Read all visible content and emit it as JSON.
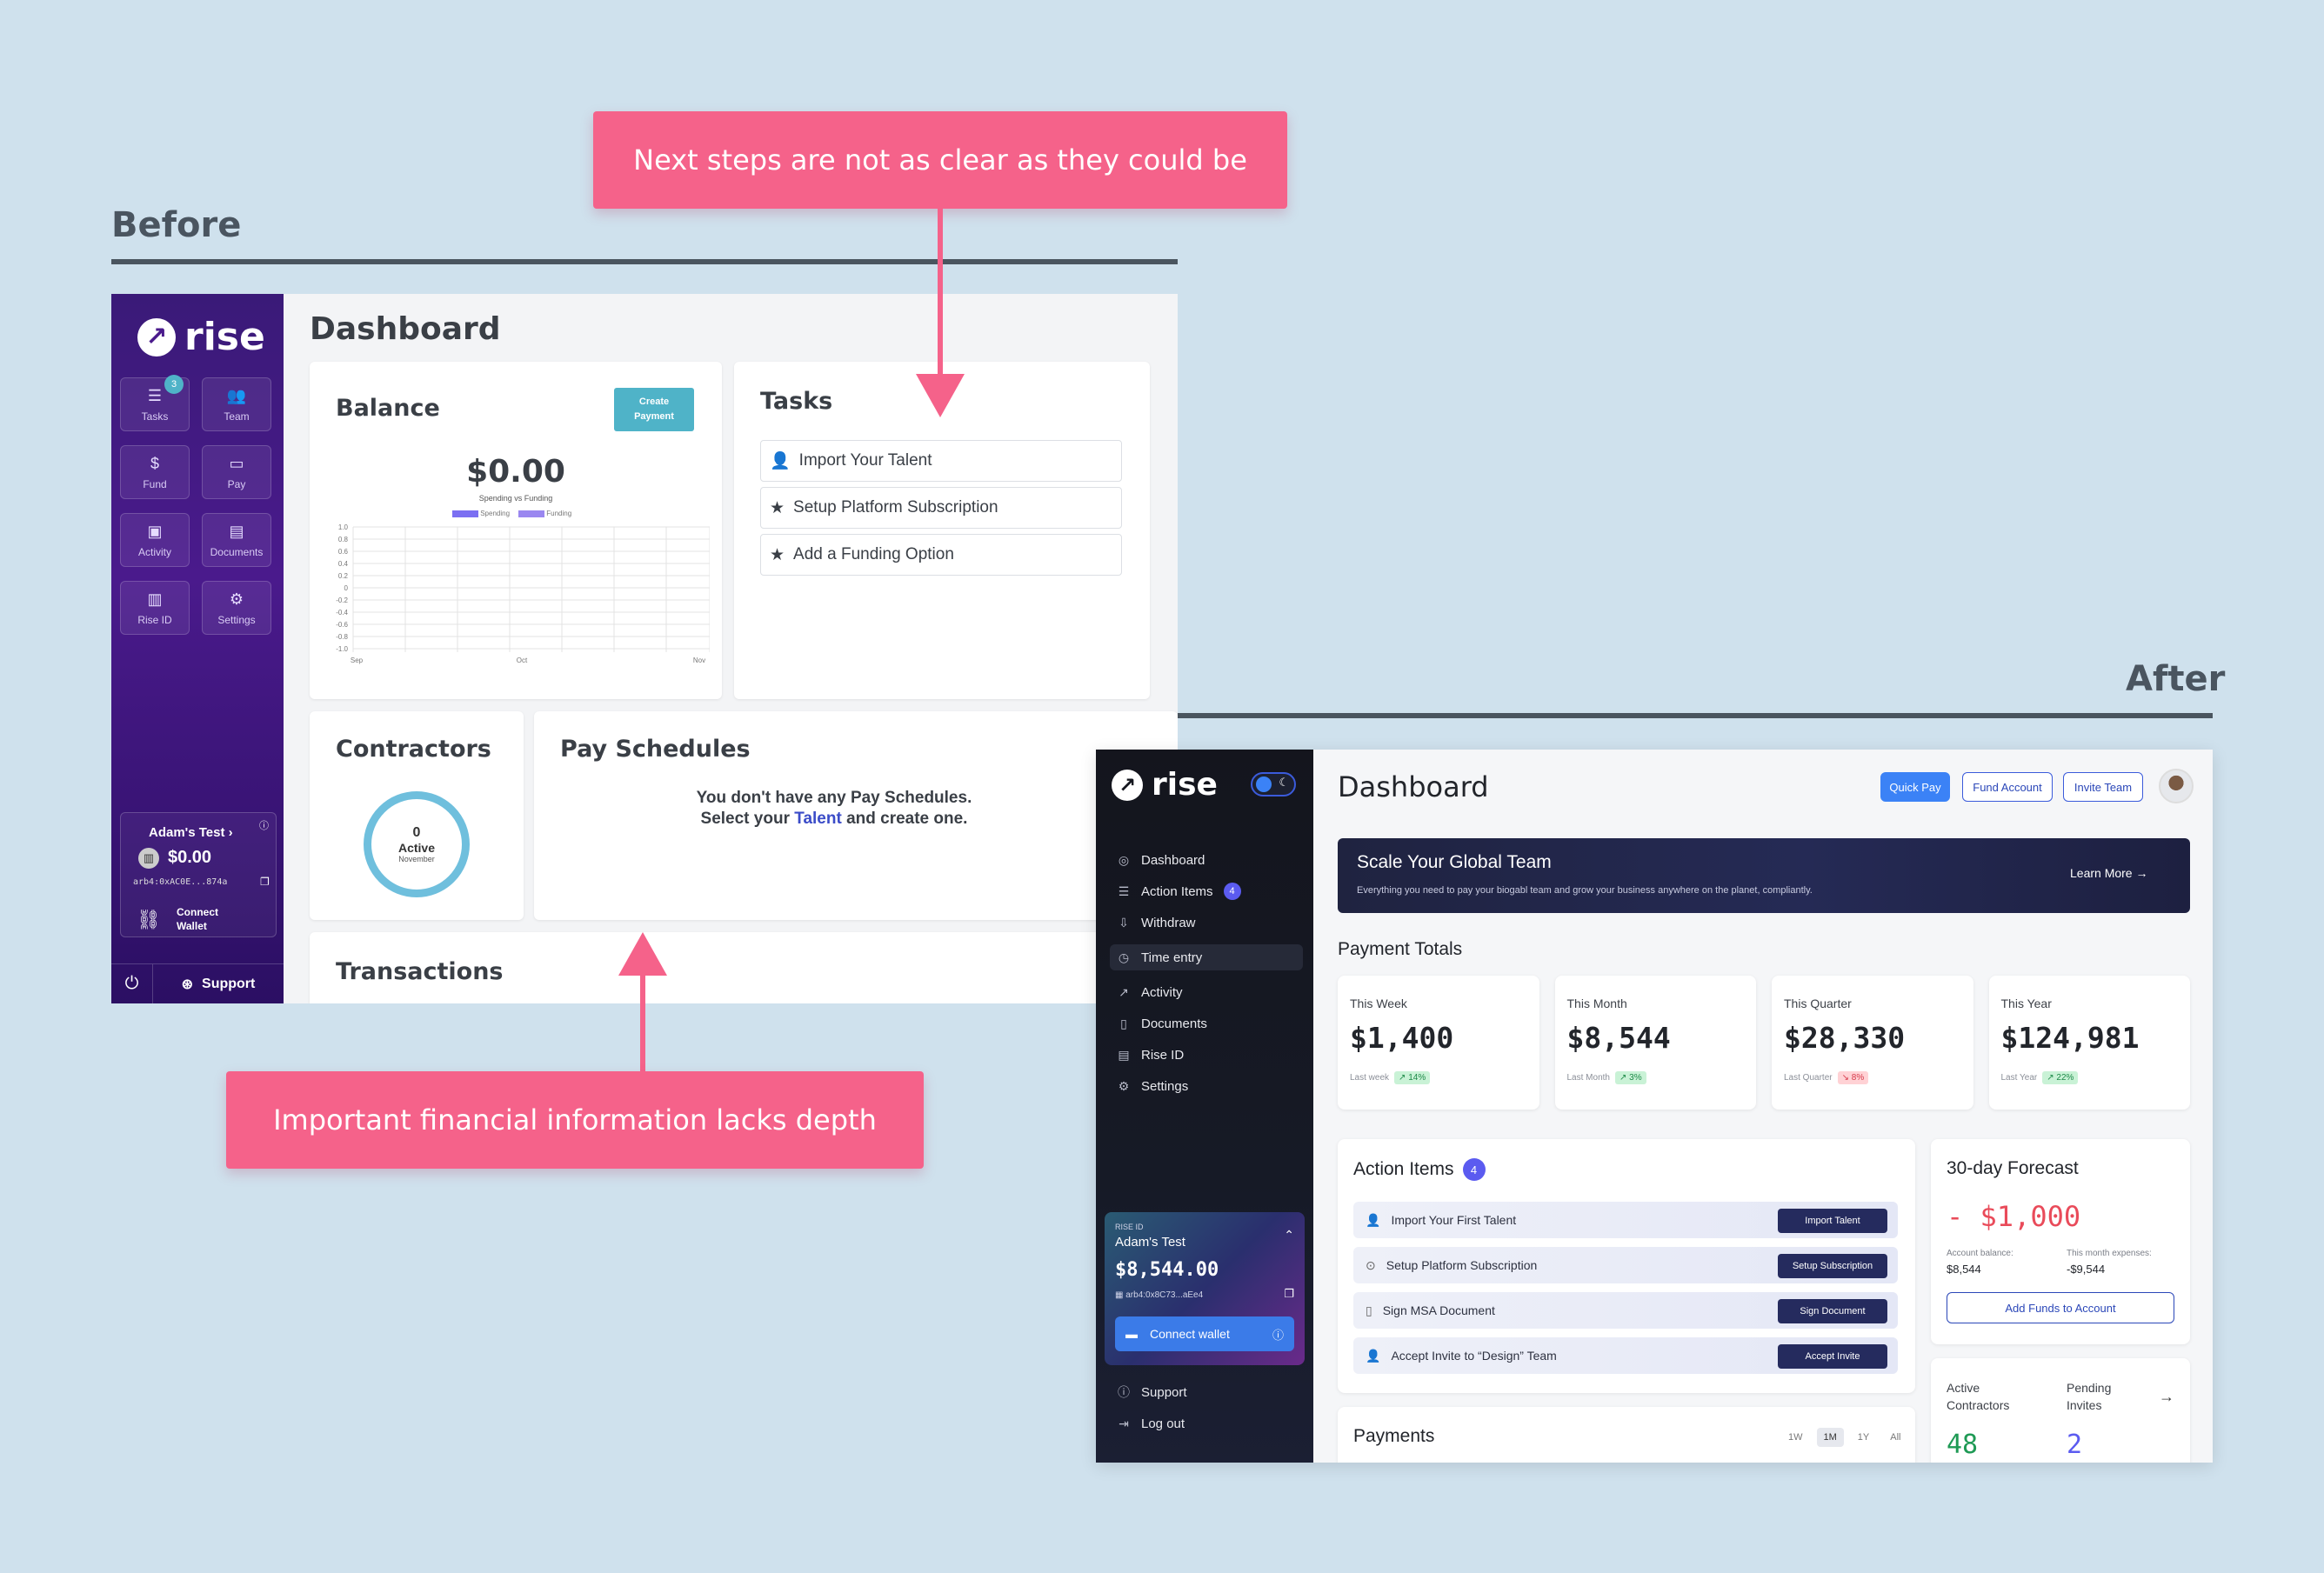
{
  "labels": {
    "before": "Before",
    "after": "After"
  },
  "callouts": {
    "top": "Next steps are not as clear as they could be",
    "bottom": "Important financial information lacks depth"
  },
  "before": {
    "logo": "rise",
    "nav": [
      {
        "label": "Tasks",
        "icon": "tasks-icon",
        "badge": "3"
      },
      {
        "label": "Team",
        "icon": "team-icon"
      },
      {
        "label": "Fund",
        "icon": "fund-icon"
      },
      {
        "label": "Pay",
        "icon": "pay-icon"
      },
      {
        "label": "Activity",
        "icon": "activity-icon"
      },
      {
        "label": "Documents",
        "icon": "documents-icon"
      },
      {
        "label": "Rise ID",
        "icon": "rise-id-icon"
      },
      {
        "label": "Settings",
        "icon": "settings-icon"
      }
    ],
    "account": {
      "name": "Adam's Test",
      "balance": "$0.00",
      "address": "arb4:0xAC0E...874a",
      "connect": "Connect Wallet"
    },
    "support": "Support",
    "title": "Dashboard",
    "balance": {
      "title": "Balance",
      "button": "Create Payment",
      "amount": "$0.00",
      "chart_caption": "Spending vs Funding"
    },
    "tasks": {
      "title": "Tasks",
      "items": [
        "Import Your Talent",
        "Setup Platform Subscription",
        "Add a Funding Option"
      ]
    },
    "contractors": {
      "title": "Contractors",
      "count": "0",
      "status": "Active",
      "month": "November"
    },
    "pay_schedules": {
      "title": "Pay Schedules",
      "line1": "You don't have any Pay Schedules.",
      "line2_pre": "Select your ",
      "line2_link": "Talent",
      "line2_post": " and create one."
    },
    "transactions": {
      "title": "Transactions"
    }
  },
  "after": {
    "logo": "rise",
    "nav": [
      "Dashboard",
      "Action Items",
      "Withdraw",
      "Time entry",
      "Activity",
      "Documents",
      "Rise ID",
      "Settings"
    ],
    "nav_badge": "4",
    "wallet": {
      "tag": "RISE ID",
      "name": "Adam's Test",
      "balance": "$8,544.00",
      "address": "arb4:0x8C73...aEe4",
      "connect": "Connect wallet"
    },
    "footer": [
      "Support",
      "Log out"
    ],
    "title": "Dashboard",
    "buttons": [
      "Quick Pay",
      "Fund Account",
      "Invite Team"
    ],
    "banner": {
      "title": "Scale Your Global Team",
      "text": "Everything you need to pay your biogabl team and grow your business anywhere on the planet, compliantly.",
      "cta": "Learn More"
    },
    "totals_title": "Payment Totals",
    "totals": [
      {
        "label": "This Week",
        "value": "$1,400",
        "sub": "Last week",
        "change": "14%",
        "dir": "up"
      },
      {
        "label": "This Month",
        "value": "$8,544",
        "sub": "Last Month",
        "change": "3%",
        "dir": "up"
      },
      {
        "label": "This Quarter",
        "value": "$28,330",
        "sub": "Last Quarter",
        "change": "8%",
        "dir": "down"
      },
      {
        "label": "This Year",
        "value": "$124,981",
        "sub": "Last Year",
        "change": "22%",
        "dir": "up"
      }
    ],
    "action_items": {
      "title": "Action Items",
      "count": "4",
      "items": [
        {
          "label": "Import Your First Talent",
          "button": "Import Talent"
        },
        {
          "label": "Setup Platform Subscription",
          "button": "Setup Subscription"
        },
        {
          "label": "Sign MSA Document",
          "button": "Sign Document"
        },
        {
          "label": "Accept Invite to “Design” Team",
          "button": "Accept Invite"
        }
      ]
    },
    "forecast": {
      "title": "30-day Forecast",
      "value": "- $1,000",
      "bal_label": "Account balance:",
      "bal": "$8,544",
      "exp_label": "This month expenses:",
      "exp": "-$9,544",
      "button": "Add Funds to Account"
    },
    "contractors": {
      "active_label": "Active Contractors",
      "active": "48",
      "pending_label": "Pending Invites",
      "pending": "2"
    },
    "payments": {
      "title": "Payments",
      "ranges": [
        "1W",
        "1M",
        "1Y",
        "All"
      ]
    }
  }
}
